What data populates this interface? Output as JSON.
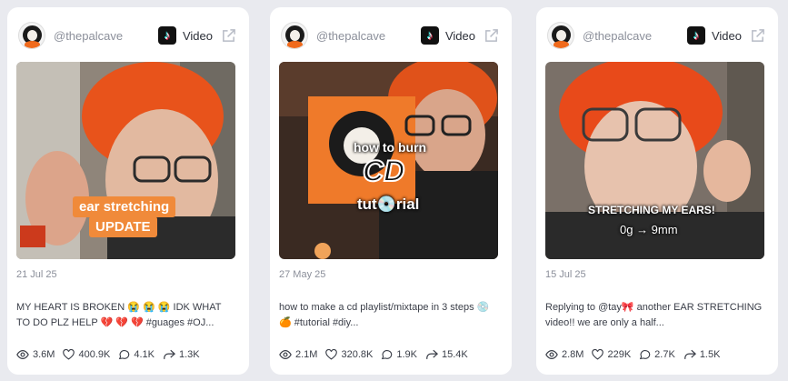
{
  "cards": [
    {
      "handle": "@thepalcave",
      "platform": "Video",
      "thumb_overlay_1": "ear stretching",
      "thumb_overlay_2": "UPDATE",
      "date": "21 Jul 25",
      "description": "MY HEART IS BROKEN 😭 😭 😭 IDK WHAT TO DO PLZ HELP 💔 💔 💔 #guages #OJ...",
      "views": "3.6M",
      "likes": "400.9K",
      "comments": "4.1K",
      "shares": "1.3K"
    },
    {
      "handle": "@thepalcave",
      "platform": "Video",
      "thumb_overlay_1": "how to burn",
      "thumb_overlay_2": "CD",
      "thumb_overlay_3": "tut💿rial",
      "date": "27 May 25",
      "description": "how to make a cd playlist/mixtape in 3 steps 💿 🍊 #tutorial #diy...",
      "views": "2.1M",
      "likes": "320.8K",
      "comments": "1.9K",
      "shares": "15.4K"
    },
    {
      "handle": "@thepalcave",
      "platform": "Video",
      "thumb_overlay_1": "STRETCHING MY EARS!",
      "thumb_overlay_2": "0g → 9mm",
      "date": "15 Jul 25",
      "description": "Replying to @tay🎀 another EAR STRETCHING video!! we are only a half...",
      "views": "2.8M",
      "likes": "229K",
      "comments": "2.7K",
      "shares": "1.5K"
    }
  ],
  "icons": {
    "platform": "tiktok-icon",
    "external": "external-link-icon",
    "views": "eye-icon",
    "likes": "heart-icon",
    "comments": "comment-icon",
    "shares": "share-icon"
  },
  "colors": {
    "background": "#e9eaef",
    "card": "#ffffff",
    "muted_text": "#8b8f9a",
    "body_text": "#3a3e48",
    "overlay_orange": "#f08a3a"
  }
}
